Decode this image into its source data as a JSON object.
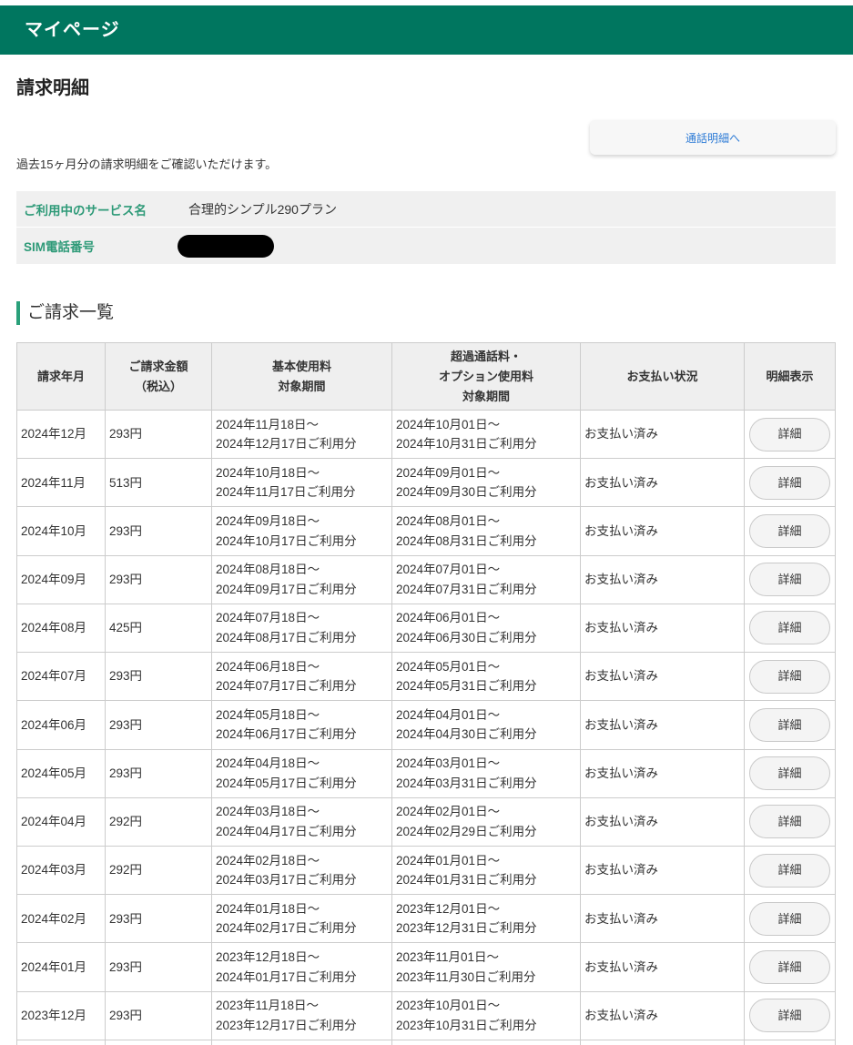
{
  "header": {
    "title": "マイページ"
  },
  "page": {
    "title": "請求明細",
    "call_detail_button": "通話明細へ",
    "intro": "過去15ヶ月分の請求明細をご確認いただけます。"
  },
  "service_info": {
    "rows": [
      {
        "label": "ご利用中のサービス名",
        "value": "合理的シンプル290プラン"
      },
      {
        "label": "SIM電話番号"
      }
    ]
  },
  "billing": {
    "heading": "ご請求一覧",
    "columns": [
      "請求年月",
      "ご請求金額\n（税込）",
      "基本使用料\n対象期間",
      "超過通話料・\nオプション使用料\n対象期間",
      "お支払い状況",
      "明細表示"
    ],
    "detail_button": "詳細",
    "rows": [
      {
        "month": "2024年12月",
        "amount": "293円",
        "basic_period": [
          "2024年11月18日～",
          "2024年12月17日ご利用分"
        ],
        "option_period": [
          "2024年10月01日～",
          "2024年10月31日ご利用分"
        ],
        "status": "お支払い済み"
      },
      {
        "month": "2024年11月",
        "amount": "513円",
        "basic_period": [
          "2024年10月18日～",
          "2024年11月17日ご利用分"
        ],
        "option_period": [
          "2024年09月01日～",
          "2024年09月30日ご利用分"
        ],
        "status": "お支払い済み"
      },
      {
        "month": "2024年10月",
        "amount": "293円",
        "basic_period": [
          "2024年09月18日～",
          "2024年10月17日ご利用分"
        ],
        "option_period": [
          "2024年08月01日～",
          "2024年08月31日ご利用分"
        ],
        "status": "お支払い済み"
      },
      {
        "month": "2024年09月",
        "amount": "293円",
        "basic_period": [
          "2024年08月18日～",
          "2024年09月17日ご利用分"
        ],
        "option_period": [
          "2024年07月01日～",
          "2024年07月31日ご利用分"
        ],
        "status": "お支払い済み"
      },
      {
        "month": "2024年08月",
        "amount": "425円",
        "basic_period": [
          "2024年07月18日～",
          "2024年08月17日ご利用分"
        ],
        "option_period": [
          "2024年06月01日～",
          "2024年06月30日ご利用分"
        ],
        "status": "お支払い済み"
      },
      {
        "month": "2024年07月",
        "amount": "293円",
        "basic_period": [
          "2024年06月18日～",
          "2024年07月17日ご利用分"
        ],
        "option_period": [
          "2024年05月01日～",
          "2024年05月31日ご利用分"
        ],
        "status": "お支払い済み"
      },
      {
        "month": "2024年06月",
        "amount": "293円",
        "basic_period": [
          "2024年05月18日～",
          "2024年06月17日ご利用分"
        ],
        "option_period": [
          "2024年04月01日～",
          "2024年04月30日ご利用分"
        ],
        "status": "お支払い済み"
      },
      {
        "month": "2024年05月",
        "amount": "293円",
        "basic_period": [
          "2024年04月18日～",
          "2024年05月17日ご利用分"
        ],
        "option_period": [
          "2024年03月01日～",
          "2024年03月31日ご利用分"
        ],
        "status": "お支払い済み"
      },
      {
        "month": "2024年04月",
        "amount": "292円",
        "basic_period": [
          "2024年03月18日～",
          "2024年04月17日ご利用分"
        ],
        "option_period": [
          "2024年02月01日～",
          "2024年02月29日ご利用分"
        ],
        "status": "お支払い済み"
      },
      {
        "month": "2024年03月",
        "amount": "292円",
        "basic_period": [
          "2024年02月18日～",
          "2024年03月17日ご利用分"
        ],
        "option_period": [
          "2024年01月01日～",
          "2024年01月31日ご利用分"
        ],
        "status": "お支払い済み"
      },
      {
        "month": "2024年02月",
        "amount": "293円",
        "basic_period": [
          "2024年01月18日～",
          "2024年02月17日ご利用分"
        ],
        "option_period": [
          "2023年12月01日～",
          "2023年12月31日ご利用分"
        ],
        "status": "お支払い済み"
      },
      {
        "month": "2024年01月",
        "amount": "293円",
        "basic_period": [
          "2023年12月18日～",
          "2024年01月17日ご利用分"
        ],
        "option_period": [
          "2023年11月01日～",
          "2023年11月30日ご利用分"
        ],
        "status": "お支払い済み"
      },
      {
        "month": "2023年12月",
        "amount": "293円",
        "basic_period": [
          "2023年11月18日～",
          "2023年12月17日ご利用分"
        ],
        "option_period": [
          "2023年10月01日～",
          "2023年10月31日ご利用分"
        ],
        "status": "お支払い済み"
      }
    ]
  },
  "colors": {
    "brand_green": "#00765f",
    "label_green": "#2e9a78",
    "section_bar": "#2aa07a",
    "link_blue": "#2d7bd6"
  }
}
